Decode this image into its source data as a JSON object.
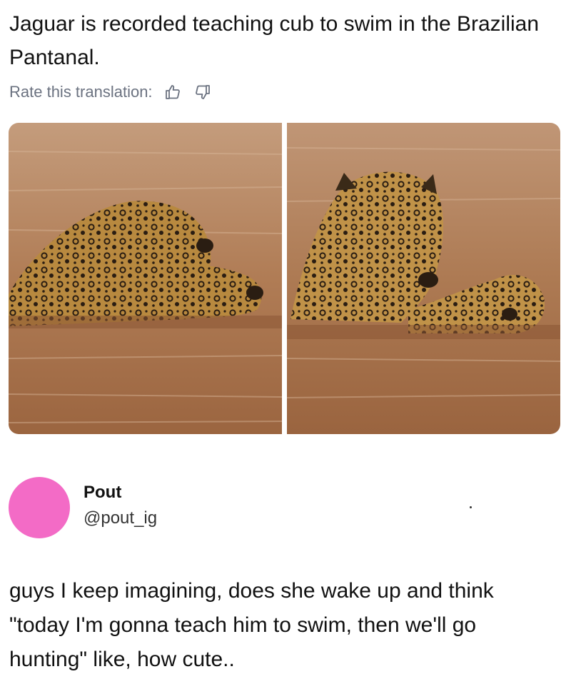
{
  "post": {
    "text": "Jaguar is recorded teaching cub to swim in the Brazilian Pantanal."
  },
  "translation": {
    "rate_label": "Rate this translation:",
    "thumbs_up_icon": "thumbs-up-icon",
    "thumbs_down_icon": "thumbs-down-icon"
  },
  "photos": [
    {
      "description_icon": "jaguar-carrying-cub-photo"
    },
    {
      "description_icon": "jaguar-swimming-with-cub-photo"
    }
  ],
  "comment": {
    "author_name": "Pout",
    "author_handle": "@pout_ig",
    "avatar_color": "#f36bc6",
    "text": "guys I keep imagining, does she wake up and think \"today I'm gonna teach him to swim, then we'll go hunting\" like, how cute.."
  },
  "colors": {
    "muted_text": "#6b7280",
    "water": "#a8734a"
  }
}
